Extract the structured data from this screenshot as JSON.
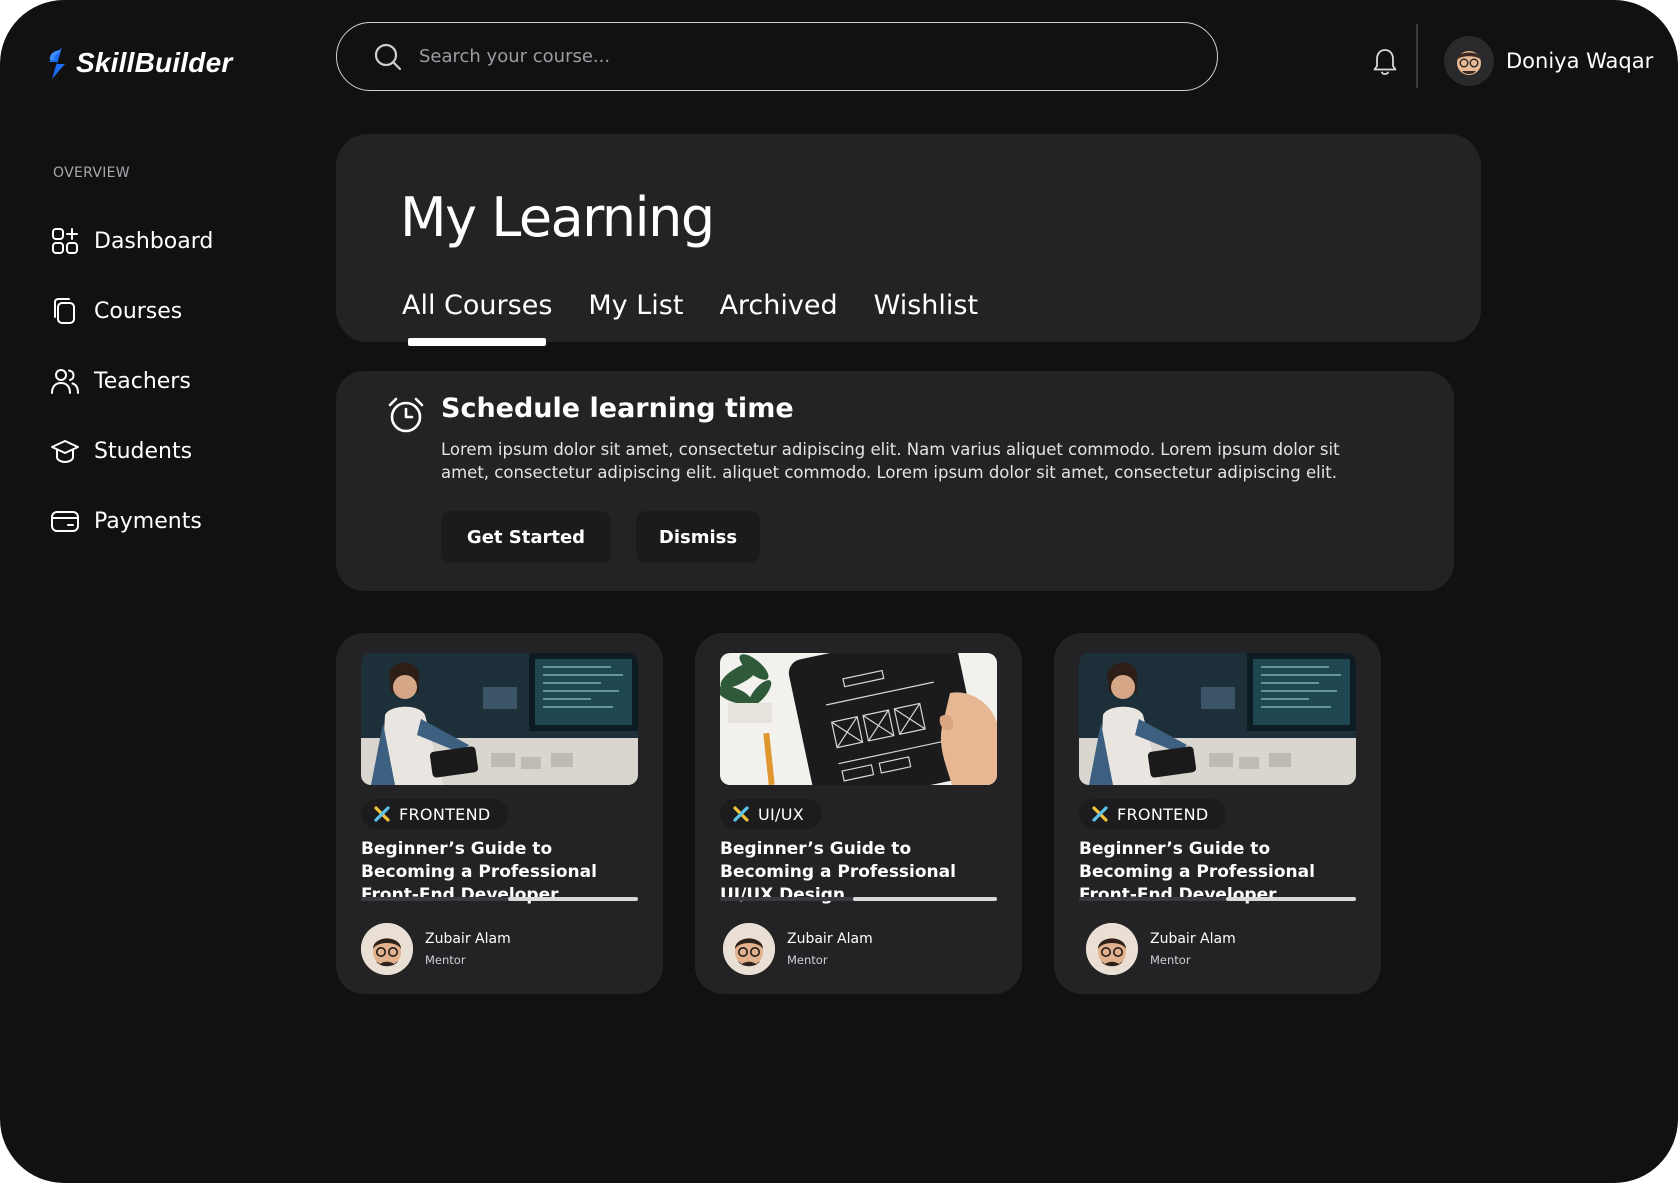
{
  "app": {
    "name": "SkillBuilder"
  },
  "search": {
    "placeholder": "Search your course..."
  },
  "user": {
    "name": "Doniya Waqar"
  },
  "sidebar": {
    "section_label": "OVERVIEW",
    "items": [
      {
        "label": "Dashboard",
        "icon": "dashboard-icon"
      },
      {
        "label": "Courses",
        "icon": "courses-icon"
      },
      {
        "label": "Teachers",
        "icon": "teachers-icon"
      },
      {
        "label": "Students",
        "icon": "students-icon"
      },
      {
        "label": "Payments",
        "icon": "payments-icon"
      }
    ]
  },
  "main": {
    "title": "My Learning",
    "tabs": [
      {
        "label": "All Courses",
        "active": true
      },
      {
        "label": "My List",
        "active": false
      },
      {
        "label": "Archived",
        "active": false
      },
      {
        "label": "Wishlist",
        "active": false
      }
    ]
  },
  "schedule": {
    "title": "Schedule learning time",
    "text": "Lorem ipsum dolor sit amet, consectetur adipiscing elit. Nam varius aliquet commodo. Lorem ipsum dolor sit amet, consectetur adipiscing elit. aliquet commodo. Lorem ipsum dolor sit amet, consectetur adipiscing elit.",
    "primary_button": "Get Started",
    "secondary_button": "Dismiss"
  },
  "courses": [
    {
      "tag": "FRONTEND",
      "title": "Beginner’s Guide to Becoming a Professional Front-End Developer",
      "progress": 0.47,
      "mentor_name": "Zubair Alam",
      "mentor_role": "Mentor",
      "thumbnail": "developer-at-desk"
    },
    {
      "tag": "UI/UX",
      "title": "Beginner’s Guide to Becoming a Professional UI/UX Design",
      "progress": 0.52,
      "mentor_name": "Zubair Alam",
      "mentor_role": "Mentor",
      "thumbnail": "tablet-wireframe"
    },
    {
      "tag": "FRONTEND",
      "title": "Beginner’s Guide to Becoming a Professional Front-End Developer",
      "progress": 0.47,
      "mentor_name": "Zubair Alam",
      "mentor_role": "Mentor",
      "thumbnail": "developer-at-desk"
    }
  ],
  "colors": {
    "background": "#111112",
    "card": "#232325",
    "brand_blue": "#1b6cf2",
    "text": "#ffffff"
  }
}
